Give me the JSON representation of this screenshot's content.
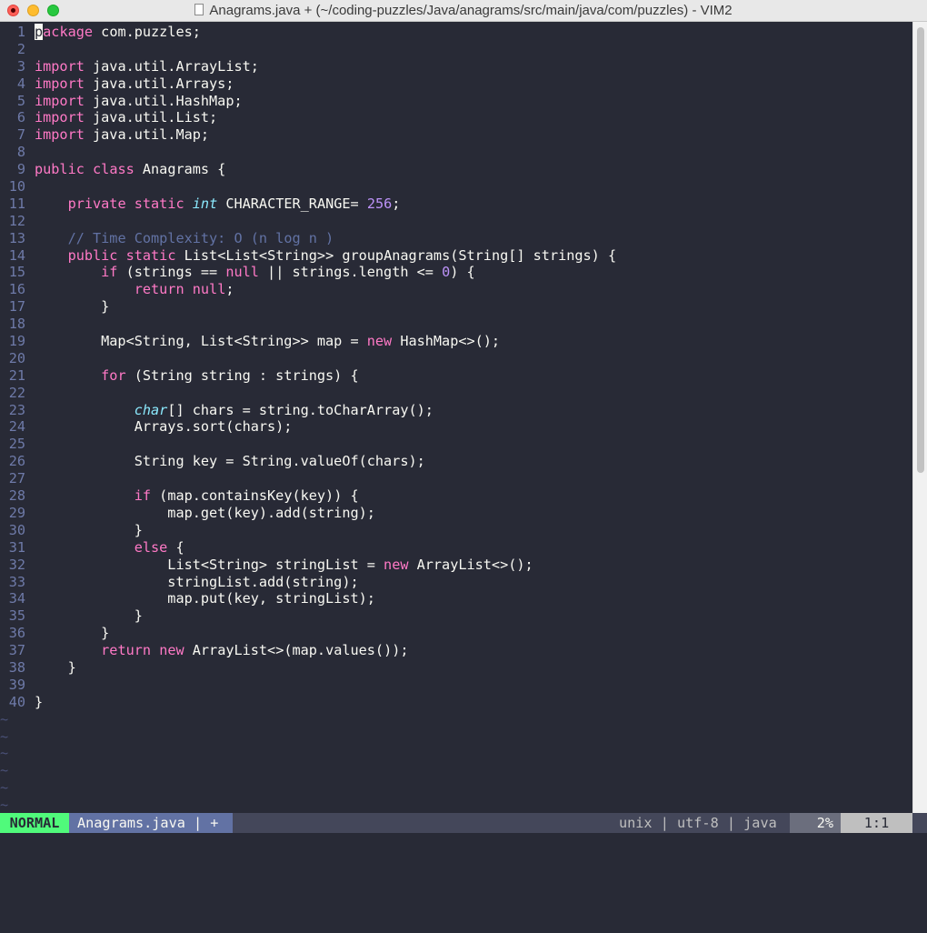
{
  "window": {
    "title": "Anagrams.java + (~/coding-puzzles/Java/anagrams/src/main/java/com/puzzles) - VIM2"
  },
  "colors": {
    "background": "#282a36",
    "foreground": "#f8f8f2",
    "keyword": "#ff79c6",
    "type": "#8be9fd",
    "number": "#bd93f9",
    "comment": "#6272a4",
    "line_number": "#6e7aa8",
    "mode_normal": "#50fa7b"
  },
  "editor": {
    "lines": [
      {
        "n": "1",
        "tokens": [
          {
            "c": "cur",
            "t": "p"
          },
          {
            "c": "kw",
            "t": "ackage"
          },
          {
            "c": "",
            "t": " com.puzzles;"
          }
        ]
      },
      {
        "n": "2",
        "tokens": []
      },
      {
        "n": "3",
        "tokens": [
          {
            "c": "kw",
            "t": "import"
          },
          {
            "c": "",
            "t": " java.util.ArrayList;"
          }
        ]
      },
      {
        "n": "4",
        "tokens": [
          {
            "c": "kw",
            "t": "import"
          },
          {
            "c": "",
            "t": " java.util.Arrays;"
          }
        ]
      },
      {
        "n": "5",
        "tokens": [
          {
            "c": "kw",
            "t": "import"
          },
          {
            "c": "",
            "t": " java.util.HashMap;"
          }
        ]
      },
      {
        "n": "6",
        "tokens": [
          {
            "c": "kw",
            "t": "import"
          },
          {
            "c": "",
            "t": " java.util.List;"
          }
        ]
      },
      {
        "n": "7",
        "tokens": [
          {
            "c": "kw",
            "t": "import"
          },
          {
            "c": "",
            "t": " java.util.Map;"
          }
        ]
      },
      {
        "n": "8",
        "tokens": []
      },
      {
        "n": "9",
        "tokens": [
          {
            "c": "kw",
            "t": "public"
          },
          {
            "c": "",
            "t": " "
          },
          {
            "c": "kw",
            "t": "class"
          },
          {
            "c": "",
            "t": " Anagrams {"
          }
        ]
      },
      {
        "n": "10",
        "tokens": []
      },
      {
        "n": "11",
        "tokens": [
          {
            "c": "",
            "t": "    "
          },
          {
            "c": "kw",
            "t": "private"
          },
          {
            "c": "",
            "t": " "
          },
          {
            "c": "kw",
            "t": "static"
          },
          {
            "c": "",
            "t": " "
          },
          {
            "c": "ty",
            "t": "int"
          },
          {
            "c": "",
            "t": " CHARACTER_RANGE= "
          },
          {
            "c": "num",
            "t": "256"
          },
          {
            "c": "",
            "t": ";"
          }
        ]
      },
      {
        "n": "12",
        "tokens": []
      },
      {
        "n": "13",
        "tokens": [
          {
            "c": "",
            "t": "    "
          },
          {
            "c": "cm",
            "t": "// Time Complexity: O (n log n )"
          }
        ]
      },
      {
        "n": "14",
        "tokens": [
          {
            "c": "",
            "t": "    "
          },
          {
            "c": "kw",
            "t": "public"
          },
          {
            "c": "",
            "t": " "
          },
          {
            "c": "kw",
            "t": "static"
          },
          {
            "c": "",
            "t": " List<List<String>> groupAnagrams(String[] strings) {"
          }
        ]
      },
      {
        "n": "15",
        "tokens": [
          {
            "c": "",
            "t": "        "
          },
          {
            "c": "kw",
            "t": "if"
          },
          {
            "c": "",
            "t": " (strings == "
          },
          {
            "c": "kw",
            "t": "null"
          },
          {
            "c": "",
            "t": " || strings.length <= "
          },
          {
            "c": "num",
            "t": "0"
          },
          {
            "c": "",
            "t": ") {"
          }
        ]
      },
      {
        "n": "16",
        "tokens": [
          {
            "c": "",
            "t": "            "
          },
          {
            "c": "kw",
            "t": "return"
          },
          {
            "c": "",
            "t": " "
          },
          {
            "c": "kw",
            "t": "null"
          },
          {
            "c": "",
            "t": ";"
          }
        ]
      },
      {
        "n": "17",
        "tokens": [
          {
            "c": "",
            "t": "        }"
          }
        ]
      },
      {
        "n": "18",
        "tokens": []
      },
      {
        "n": "19",
        "tokens": [
          {
            "c": "",
            "t": "        Map<String, List<String>> map = "
          },
          {
            "c": "kw",
            "t": "new"
          },
          {
            "c": "",
            "t": " HashMap<>();"
          }
        ]
      },
      {
        "n": "20",
        "tokens": []
      },
      {
        "n": "21",
        "tokens": [
          {
            "c": "",
            "t": "        "
          },
          {
            "c": "kw",
            "t": "for"
          },
          {
            "c": "",
            "t": " (String string : strings) {"
          }
        ]
      },
      {
        "n": "22",
        "tokens": []
      },
      {
        "n": "23",
        "tokens": [
          {
            "c": "",
            "t": "            "
          },
          {
            "c": "ty",
            "t": "char"
          },
          {
            "c": "",
            "t": "[] chars = string.toCharArray();"
          }
        ]
      },
      {
        "n": "24",
        "tokens": [
          {
            "c": "",
            "t": "            Arrays.sort(chars);"
          }
        ]
      },
      {
        "n": "25",
        "tokens": []
      },
      {
        "n": "26",
        "tokens": [
          {
            "c": "",
            "t": "            String key = String.valueOf(chars);"
          }
        ]
      },
      {
        "n": "27",
        "tokens": []
      },
      {
        "n": "28",
        "tokens": [
          {
            "c": "",
            "t": "            "
          },
          {
            "c": "kw",
            "t": "if"
          },
          {
            "c": "",
            "t": " (map.containsKey(key)) {"
          }
        ]
      },
      {
        "n": "29",
        "tokens": [
          {
            "c": "",
            "t": "                map.get(key).add(string);"
          }
        ]
      },
      {
        "n": "30",
        "tokens": [
          {
            "c": "",
            "t": "            }"
          }
        ]
      },
      {
        "n": "31",
        "tokens": [
          {
            "c": "",
            "t": "            "
          },
          {
            "c": "kw",
            "t": "else"
          },
          {
            "c": "",
            "t": " {"
          }
        ]
      },
      {
        "n": "32",
        "tokens": [
          {
            "c": "",
            "t": "                List<String> stringList = "
          },
          {
            "c": "kw",
            "t": "new"
          },
          {
            "c": "",
            "t": " ArrayList<>();"
          }
        ]
      },
      {
        "n": "33",
        "tokens": [
          {
            "c": "",
            "t": "                stringList.add(string);"
          }
        ]
      },
      {
        "n": "34",
        "tokens": [
          {
            "c": "",
            "t": "                map.put(key, stringList);"
          }
        ]
      },
      {
        "n": "35",
        "tokens": [
          {
            "c": "",
            "t": "            }"
          }
        ]
      },
      {
        "n": "36",
        "tokens": [
          {
            "c": "",
            "t": "        }"
          }
        ]
      },
      {
        "n": "37",
        "tokens": [
          {
            "c": "",
            "t": "        "
          },
          {
            "c": "kw",
            "t": "return"
          },
          {
            "c": "",
            "t": " "
          },
          {
            "c": "kw",
            "t": "new"
          },
          {
            "c": "",
            "t": " ArrayList<>(map.values());"
          }
        ]
      },
      {
        "n": "38",
        "tokens": [
          {
            "c": "",
            "t": "    }"
          }
        ]
      },
      {
        "n": "39",
        "tokens": []
      },
      {
        "n": "40",
        "tokens": [
          {
            "c": "",
            "t": "}"
          }
        ]
      }
    ],
    "empty_marker": "~",
    "empty_marker_count": 6
  },
  "statusline": {
    "mode": "NORMAL",
    "file": "Anagrams.java | +",
    "info": "unix | utf-8 | java",
    "percent": "2%",
    "position": "1:1"
  }
}
